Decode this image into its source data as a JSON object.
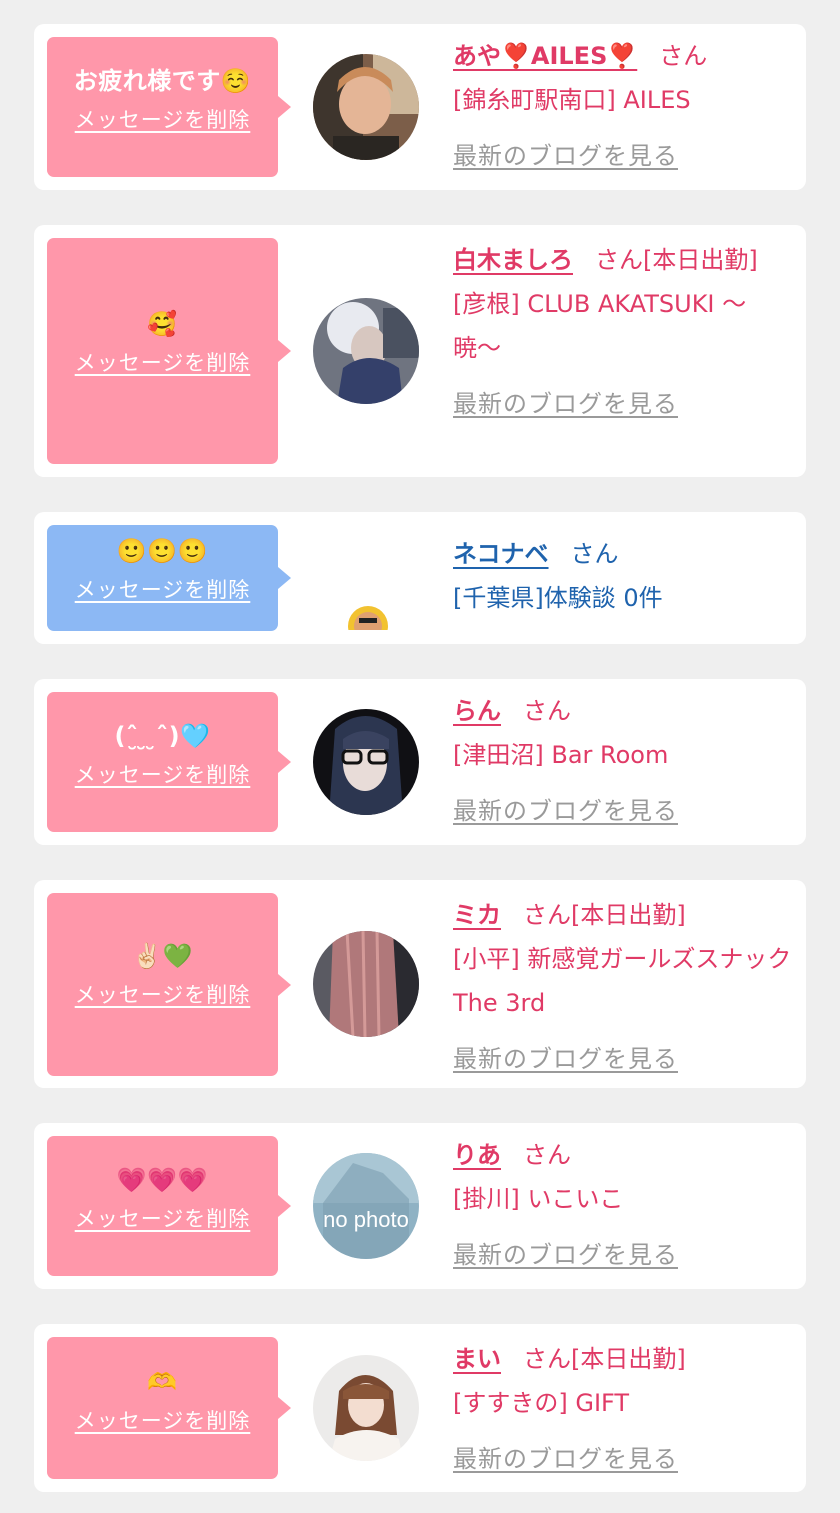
{
  "delete_label": "メッセージを削除",
  "blog_label": "最新のブログを見る",
  "honorific": "さん",
  "colors": {
    "pink_bubble": "#ff97aa",
    "blue_bubble": "#8cb8f4",
    "pink_text": "#e03a66",
    "blue_text": "#1f63ad",
    "link_gray": "#9a9a9a"
  },
  "cards": [
    {
      "message": "お疲れ様です☺️",
      "name": "あや❣️AILES❣️",
      "status": "",
      "shop": "[錦糸町駅南口] AILES",
      "blog": true,
      "avatar": "person-photo-avatar"
    },
    {
      "message": "🥰",
      "name": "白木ましろ",
      "status": "[本日出勤]",
      "shop": "[彦根] CLUB AKATSUKI 〜暁〜",
      "blog": true,
      "avatar": "person-photo-avatar"
    },
    {
      "message": "🙂🙂🙂",
      "name": "ネコナベ",
      "status": "",
      "shop": "[千葉県]体験談 0件",
      "blog": false,
      "avatar": "small-emoji-avatar"
    },
    {
      "message": "(ˆ̮ ̮ ̮ˆ)🩵",
      "name": "らん",
      "status": "",
      "shop": "[津田沼] Bar Room",
      "blog": true,
      "avatar": "person-photo-avatar"
    },
    {
      "message": "✌🏻💚",
      "name": "ミカ",
      "status": "[本日出勤]",
      "shop": "[小平] 新感覚ガールズスナック The 3rd",
      "blog": true,
      "avatar": "hair-photo-avatar"
    },
    {
      "message": "💗💗💗",
      "name": "りあ",
      "status": "",
      "shop": "[掛川] いこいこ",
      "blog": true,
      "avatar": "no-photo-avatar",
      "avatar_text": "no photo"
    },
    {
      "message": "🫶",
      "name": "まい",
      "status": "[本日出勤]",
      "shop": "[すすきの] GIFT",
      "blog": true,
      "avatar": "person-photo-avatar"
    }
  ]
}
